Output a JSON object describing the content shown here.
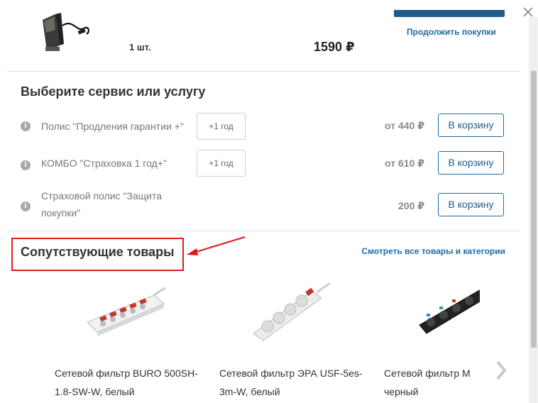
{
  "cart_item": {
    "quantity": "1 шт.",
    "price": "1590 ₽",
    "continue_label": "Продолжить покупки"
  },
  "services": {
    "title": "Выберите сервис или услугу",
    "items": [
      {
        "label": "Полис \"Продления гарантии +\"",
        "term": "+1 год",
        "price": "от 440 ₽",
        "cart_label": "В корзину"
      },
      {
        "label": "КОМБО \"Страховка 1 год+\"",
        "term": "+1 год",
        "price": "от 610 ₽",
        "cart_label": "В корзину"
      },
      {
        "label": "Страховой полис \"Защита покупки\"",
        "term": "",
        "price": "200 ₽",
        "cart_label": "В корзину"
      }
    ]
  },
  "related": {
    "title": "Сопутствующие товары",
    "view_all": "Смотреть все товары и категории",
    "products": [
      {
        "name": "Сетевой фильтр BURO 500SH-1.8-SW-W, белый"
      },
      {
        "name": "Сетевой фильтр ЭРА USF-5es-3m-W, белый"
      },
      {
        "name": "Сетевой фильтр М черный"
      }
    ]
  },
  "icons": {
    "close": "close-icon",
    "info": "info-icon",
    "next": "chevron-right-icon"
  },
  "colors": {
    "accent": "#1f6aa5",
    "highlight": "#e11a1a"
  }
}
